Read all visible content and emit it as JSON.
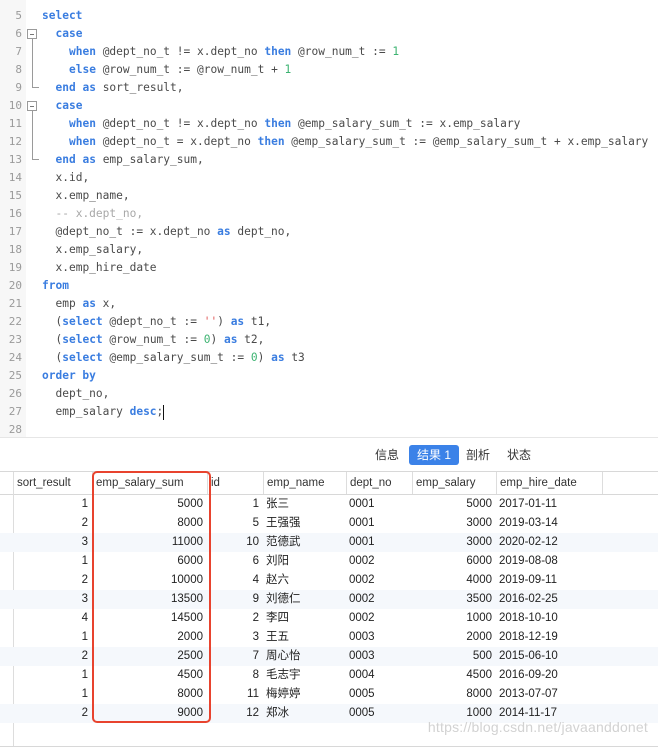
{
  "editor": {
    "lines": [
      {
        "n": "5",
        "tokens": [
          [
            "kw",
            "select"
          ]
        ],
        "indent": 0
      },
      {
        "n": "6",
        "tokens": [
          [
            "kw",
            "case"
          ]
        ],
        "indent": 1,
        "fold": "open"
      },
      {
        "n": "7",
        "tokens": [
          [
            "kw",
            "when"
          ],
          [
            "t",
            " @dept_no_t != x.dept_no "
          ],
          [
            "kw",
            "then"
          ],
          [
            "t",
            " @row_num_t := "
          ],
          [
            "num",
            "1"
          ]
        ],
        "indent": 2,
        "fold": "mid"
      },
      {
        "n": "8",
        "tokens": [
          [
            "kw",
            "else"
          ],
          [
            "t",
            " @row_num_t := @row_num_t + "
          ],
          [
            "num",
            "1"
          ]
        ],
        "indent": 2,
        "fold": "mid"
      },
      {
        "n": "9",
        "tokens": [
          [
            "kw",
            "end"
          ],
          [
            "t",
            " "
          ],
          [
            "kw",
            "as"
          ],
          [
            "t",
            " sort_result,"
          ]
        ],
        "indent": 1,
        "fold": "end"
      },
      {
        "n": "10",
        "tokens": [
          [
            "kw",
            "case"
          ]
        ],
        "indent": 1,
        "fold": "open"
      },
      {
        "n": "11",
        "tokens": [
          [
            "kw",
            "when"
          ],
          [
            "t",
            " @dept_no_t != x.dept_no "
          ],
          [
            "kw",
            "then"
          ],
          [
            "t",
            " @emp_salary_sum_t := x.emp_salary"
          ]
        ],
        "indent": 2,
        "fold": "mid"
      },
      {
        "n": "12",
        "tokens": [
          [
            "kw",
            "when"
          ],
          [
            "t",
            " @dept_no_t = x.dept_no "
          ],
          [
            "kw",
            "then"
          ],
          [
            "t",
            " @emp_salary_sum_t := @emp_salary_sum_t + x.emp_salary"
          ]
        ],
        "indent": 2,
        "fold": "mid"
      },
      {
        "n": "13",
        "tokens": [
          [
            "kw",
            "end"
          ],
          [
            "t",
            " "
          ],
          [
            "kw",
            "as"
          ],
          [
            "t",
            " emp_salary_sum,"
          ]
        ],
        "indent": 1,
        "fold": "end"
      },
      {
        "n": "14",
        "tokens": [
          [
            "t",
            "x.id,"
          ]
        ],
        "indent": 1
      },
      {
        "n": "15",
        "tokens": [
          [
            "t",
            "x.emp_name,"
          ]
        ],
        "indent": 1
      },
      {
        "n": "16",
        "tokens": [
          [
            "cmt",
            "-- x.dept_no,"
          ]
        ],
        "indent": 1
      },
      {
        "n": "17",
        "tokens": [
          [
            "t",
            "@dept_no_t := x.dept_no "
          ],
          [
            "kw",
            "as"
          ],
          [
            "t",
            " dept_no,"
          ]
        ],
        "indent": 1
      },
      {
        "n": "18",
        "tokens": [
          [
            "t",
            "x.emp_salary,"
          ]
        ],
        "indent": 1
      },
      {
        "n": "19",
        "tokens": [
          [
            "t",
            "x.emp_hire_date"
          ]
        ],
        "indent": 1
      },
      {
        "n": "20",
        "tokens": [
          [
            "kw",
            "from"
          ]
        ],
        "indent": 0
      },
      {
        "n": "21",
        "tokens": [
          [
            "t",
            "emp "
          ],
          [
            "kw",
            "as"
          ],
          [
            "t",
            " x,"
          ]
        ],
        "indent": 1
      },
      {
        "n": "22",
        "tokens": [
          [
            "t",
            "("
          ],
          [
            "kw",
            "select"
          ],
          [
            "t",
            " @dept_no_t := "
          ],
          [
            "str",
            "''"
          ],
          [
            "t",
            ") "
          ],
          [
            "kw",
            "as"
          ],
          [
            "t",
            " t1,"
          ]
        ],
        "indent": 1
      },
      {
        "n": "23",
        "tokens": [
          [
            "t",
            "("
          ],
          [
            "kw",
            "select"
          ],
          [
            "t",
            " @row_num_t := "
          ],
          [
            "num",
            "0"
          ],
          [
            "t",
            ") "
          ],
          [
            "kw",
            "as"
          ],
          [
            "t",
            " t2,"
          ]
        ],
        "indent": 1
      },
      {
        "n": "24",
        "tokens": [
          [
            "t",
            "("
          ],
          [
            "kw",
            "select"
          ],
          [
            "t",
            " @emp_salary_sum_t := "
          ],
          [
            "num",
            "0"
          ],
          [
            "t",
            ") "
          ],
          [
            "kw",
            "as"
          ],
          [
            "t",
            " t3"
          ]
        ],
        "indent": 1
      },
      {
        "n": "25",
        "tokens": [
          [
            "kw",
            "order by"
          ]
        ],
        "indent": 0
      },
      {
        "n": "26",
        "tokens": [
          [
            "t",
            "dept_no,"
          ]
        ],
        "indent": 1
      },
      {
        "n": "27",
        "tokens": [
          [
            "t",
            "emp_salary "
          ],
          [
            "kw",
            "desc"
          ],
          [
            "t",
            ";"
          ]
        ],
        "indent": 1,
        "cursor": true
      },
      {
        "n": "28",
        "tokens": [],
        "indent": 0
      }
    ]
  },
  "tabs": [
    {
      "label": "信息",
      "active": false
    },
    {
      "label": "结果 1",
      "active": true
    },
    {
      "label": "剖析",
      "active": false
    },
    {
      "label": "状态",
      "active": false
    }
  ],
  "grid": {
    "columns": [
      "sort_result",
      "emp_salary_sum",
      "id",
      "emp_name",
      "dept_no",
      "emp_salary",
      "emp_hire_date"
    ],
    "rows": [
      [
        "1",
        "5000",
        "1",
        "张三",
        "0001",
        "5000",
        "2017-01-11"
      ],
      [
        "2",
        "8000",
        "5",
        "王强强",
        "0001",
        "3000",
        "2019-03-14"
      ],
      [
        "3",
        "11000",
        "10",
        "范德武",
        "0001",
        "3000",
        "2020-02-12"
      ],
      [
        "1",
        "6000",
        "6",
        "刘阳",
        "0002",
        "6000",
        "2019-08-08"
      ],
      [
        "2",
        "10000",
        "4",
        "赵六",
        "0002",
        "4000",
        "2019-09-11"
      ],
      [
        "3",
        "13500",
        "9",
        "刘德仁",
        "0002",
        "3500",
        "2016-02-25"
      ],
      [
        "4",
        "14500",
        "2",
        "李四",
        "0002",
        "1000",
        "2018-10-10"
      ],
      [
        "1",
        "2000",
        "3",
        "王五",
        "0003",
        "2000",
        "2018-12-19"
      ],
      [
        "2",
        "2500",
        "7",
        "周心怡",
        "0003",
        "500",
        "2015-06-10"
      ],
      [
        "1",
        "4500",
        "8",
        "毛志宇",
        "0004",
        "4500",
        "2016-09-20"
      ],
      [
        "1",
        "8000",
        "11",
        "梅婷婷",
        "0005",
        "8000",
        "2013-07-07"
      ],
      [
        "2",
        "9000",
        "12",
        "郑冰",
        "0005",
        "1000",
        "2014-11-17"
      ]
    ],
    "highlighted_column": "emp_salary_sum",
    "highlight_color": "#e8432e"
  },
  "watermark": "https://blog.csdn.net/javaanddonet",
  "colors": {
    "keyword": "#3a7de0",
    "number": "#3cb371",
    "string": "#e05a5a",
    "comment": "#a8a8a8",
    "active_tab": "#3b82e8"
  }
}
